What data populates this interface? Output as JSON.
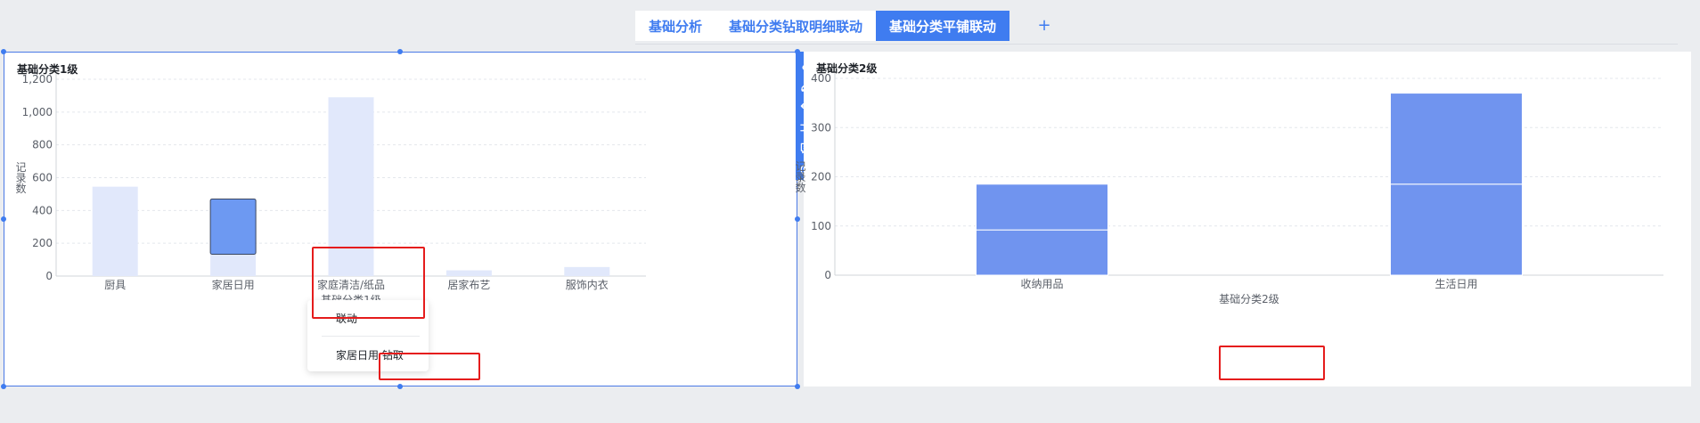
{
  "tabs": [
    {
      "label": "基础分析",
      "active": false
    },
    {
      "label": "基础分类钻取明细联动",
      "active": false
    },
    {
      "label": "基础分类平铺联动",
      "active": true
    }
  ],
  "tab_add": "+",
  "left_panel": {
    "title": "基础分类1级"
  },
  "right_panel": {
    "title": "基础分类2级"
  },
  "context_menu": {
    "items": [
      "联动",
      "家居日用 钻取"
    ]
  },
  "toolbar_icons": [
    "link-icon",
    "edit-icon",
    "undo-icon",
    "shuffle-icon",
    "comment-icon",
    "chevron-circle-down-icon"
  ],
  "colors": {
    "accent": "#3f7cf0",
    "bar_light": "#e1e8fb",
    "bar_dark": "#7094ef",
    "highlight": "#6d99f2",
    "annotation": "#e51c1c"
  },
  "chart_data": [
    {
      "type": "bar",
      "categories": [
        "厨具",
        "家居日用",
        "家庭清洁/纸品",
        "居家布艺",
        "服饰内衣"
      ],
      "values": [
        545,
        470,
        1090,
        35,
        55
      ],
      "highlighted_category": "家居日用",
      "xlabel": "基础分类1级",
      "ylabel": "记录数",
      "ylim": [
        0,
        1200
      ],
      "yticks": [
        "0",
        "200",
        "400",
        "600",
        "800",
        "1,000",
        "1,200"
      ],
      "grid": true
    },
    {
      "type": "bar",
      "categories": [
        "收纳用品",
        "生活日用"
      ],
      "series": [
        {
          "values": [
            92,
            185
          ]
        },
        {
          "values": [
            93,
            185
          ]
        }
      ],
      "xlabel": "基础分类2级",
      "ylabel": "记录数",
      "ylim": [
        0,
        400
      ],
      "yticks": [
        "0",
        "100",
        "200",
        "300",
        "400"
      ],
      "grid": true
    }
  ]
}
